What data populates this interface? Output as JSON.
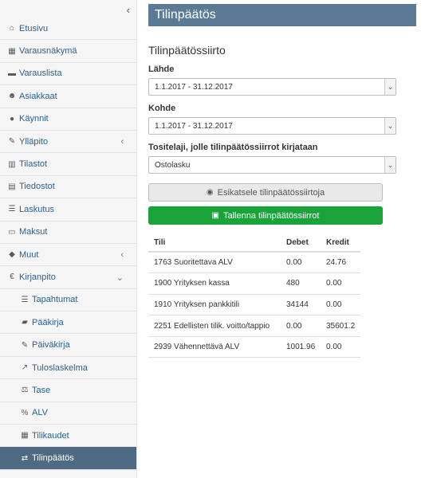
{
  "sidebar": {
    "collapse_icon": "chevron-left-icon",
    "items": [
      {
        "label": "Etusivu",
        "icon": "home-icon"
      },
      {
        "label": "Varausnäkymä",
        "icon": "calendar-icon"
      },
      {
        "label": "Varauslista",
        "icon": "list-icon"
      },
      {
        "label": "Asiakkaat",
        "icon": "users-icon"
      },
      {
        "label": "Käynnit",
        "icon": "globe-icon"
      },
      {
        "label": "Ylläpito",
        "icon": "pencil-icon",
        "chevron": "chevron-left-icon"
      },
      {
        "label": "Tilastot",
        "icon": "bar-chart-icon"
      },
      {
        "label": "Tiedostot",
        "icon": "file-icon"
      },
      {
        "label": "Laskutus",
        "icon": "list-icon"
      },
      {
        "label": "Maksut",
        "icon": "credit-card-icon"
      },
      {
        "label": "Muut",
        "icon": "cube-icon",
        "chevron": "chevron-left-icon"
      },
      {
        "label": "Kirjanpito",
        "icon": "euro-icon",
        "chevron": "chevron-down-icon"
      }
    ],
    "subitems": [
      {
        "label": "Tapahtumat",
        "icon": "list-icon"
      },
      {
        "label": "Pääkirja",
        "icon": "book-icon"
      },
      {
        "label": "Päiväkirja",
        "icon": "edit-icon"
      },
      {
        "label": "Tuloslaskelma",
        "icon": "line-chart-icon"
      },
      {
        "label": "Tase",
        "icon": "balance-scale-icon"
      },
      {
        "label": "ALV",
        "icon": "percent-icon"
      },
      {
        "label": "Tilikaudet",
        "icon": "calendar-icon"
      },
      {
        "label": "Tilinpäätös",
        "icon": "exchange-icon",
        "active": true
      }
    ]
  },
  "header": {
    "title": "Tilinpäätös"
  },
  "form": {
    "section_title": "Tilinpäätössiirto",
    "source_label": "Lähde",
    "source_value": "1.1.2017 - 31.12.2017",
    "target_label": "Kohde",
    "target_value": "1.1.2017 - 31.12.2017",
    "doctype_label": "Tositelaji, jolle tilinpäätössiirrot kirjataan",
    "doctype_value": "Ostolasku",
    "preview_button": "Esikatsele tilinpäätössiirtoja",
    "save_button": "Tallenna tilinpäätössiirrot"
  },
  "table": {
    "headers": [
      "Tili",
      "Debet",
      "Kredit"
    ],
    "rows": [
      [
        "1763 Suoritettava ALV",
        "0.00",
        "24.76"
      ],
      [
        "1900 Yrityksen kassa",
        "480",
        "0.00"
      ],
      [
        "1910 Yrityksen pankkitili",
        "34144",
        "0.00"
      ],
      [
        "2251 Edellisten tilik. voitto/tappio",
        "0.00",
        "35601.2"
      ],
      [
        "2939 Vähennettävä ALV",
        "1001.96",
        "0.00"
      ]
    ]
  },
  "colors": {
    "header_bg": "#5b7a96",
    "save_bg": "#1aa33a",
    "active_nav_bg": "#4f6b84"
  }
}
